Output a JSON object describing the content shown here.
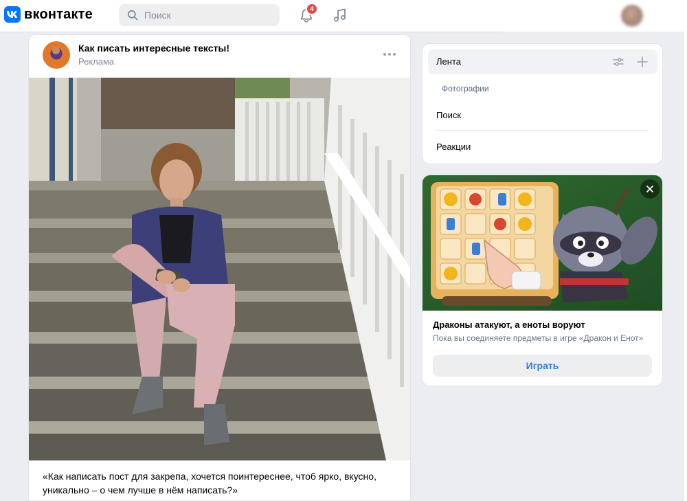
{
  "header": {
    "logo_text": "вконтакте",
    "search_placeholder": "Поиск",
    "notifications_count": "4",
    "icons": [
      "vk-logo-icon",
      "search-icon",
      "bell-icon",
      "music-icon",
      "avatar"
    ]
  },
  "post": {
    "author": "Как писать интересные тексты!",
    "subtitle": "Реклама",
    "text": "«Как написать пост для закрепа, хочется поинтереснее, чтоб ярко, вкусно, уникально – о чем лучше в нём написать?»",
    "icons": [
      "more-icon"
    ]
  },
  "menu": {
    "feed_label": "Лента",
    "photos_label": "Фотографии",
    "search_label": "Поиск",
    "reactions_label": "Реакции",
    "icons": [
      "filter-icon",
      "plus-icon"
    ]
  },
  "ad": {
    "title": "Драконы атакуют, а еноты воруют",
    "description": "Пока вы соединяете предметы в игре «Дракон и Енот»",
    "button_label": "Играть",
    "icons": [
      "close-icon"
    ]
  },
  "colors": {
    "accent": "#0077ff",
    "badge": "#e64646",
    "button_text": "#2d81e0",
    "page_bg": "#ebedf0"
  }
}
